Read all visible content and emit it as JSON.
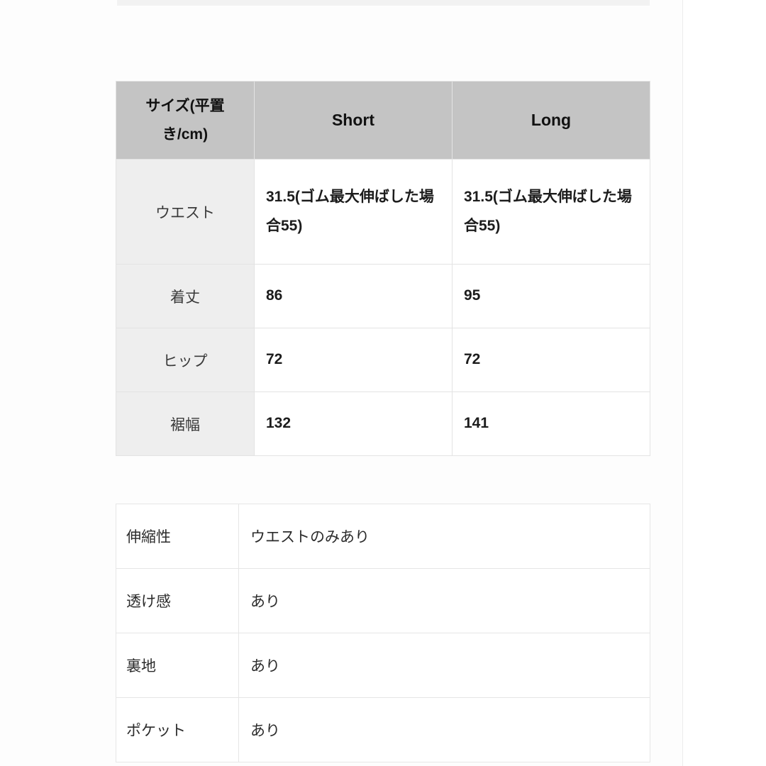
{
  "size_table": {
    "headers": [
      "サイズ(平置き/cm)",
      "Short",
      "Long"
    ],
    "rows": [
      {
        "label": "ウエスト",
        "short": "31.5(ゴム最大伸ばした場合55)",
        "long": "31.5(ゴム最大伸ばした場合55)"
      },
      {
        "label": "着丈",
        "short": "86",
        "long": "95"
      },
      {
        "label": "ヒップ",
        "short": "72",
        "long": "72"
      },
      {
        "label": "裾幅",
        "short": "132",
        "long": "141"
      }
    ]
  },
  "spec_table": {
    "rows": [
      {
        "label": "伸縮性",
        "value": "ウエストのみあり"
      },
      {
        "label": "透け感",
        "value": "あり"
      },
      {
        "label": "裏地",
        "value": "あり"
      },
      {
        "label": "ポケット",
        "value": "あり"
      }
    ]
  },
  "colors": {
    "header_bg": "#c4c4c4",
    "row_label_bg": "#eeeeee",
    "border": "#e3e3e3",
    "text": "#222222",
    "page_bg": "#ffffff"
  }
}
